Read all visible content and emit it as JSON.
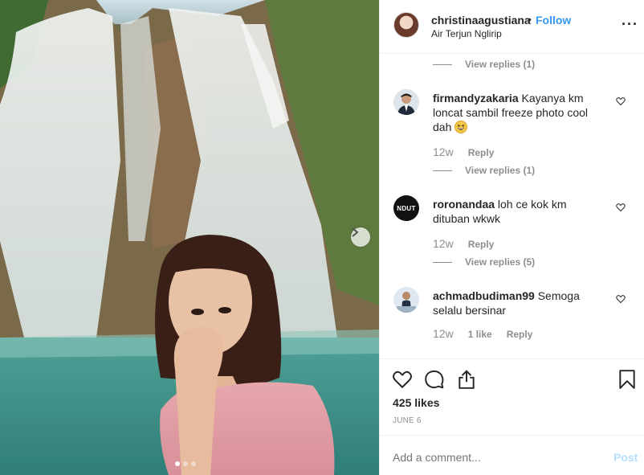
{
  "post": {
    "author": "christinaagustiana",
    "separator": "•",
    "follow_label": "Follow",
    "location": "Air Terjun Nglirip",
    "more_label": "···",
    "carousel": {
      "slides": 3,
      "active_index": 0
    }
  },
  "comments": {
    "top_view_replies": "View replies (1)",
    "items": [
      {
        "username": "firmandyzakaria",
        "text": "Kayanya km loncat sambil freeze photo cool dah",
        "emoji": "grinning-squint-emoji",
        "time": "12w",
        "reply_label": "Reply",
        "view_replies": "View replies (1)"
      },
      {
        "username": "roronandaa",
        "text": "loh ce kok km dituban wkwk",
        "avatar_text": "NDUT",
        "time": "12w",
        "reply_label": "Reply",
        "view_replies": "View replies (5)"
      },
      {
        "username": "achmadbudiman99",
        "text": "Semoga selalu bersinar",
        "time": "12w",
        "likes_label": "1 like",
        "reply_label": "Reply"
      }
    ]
  },
  "actions": {
    "likes": "425 likes",
    "date": "JUNE 6"
  },
  "add_comment": {
    "placeholder": "Add a comment...",
    "post_label": "Post"
  },
  "colors": {
    "accent": "#3897f0",
    "muted": "#8e8e8e",
    "post_disabled": "#b2dffc"
  }
}
